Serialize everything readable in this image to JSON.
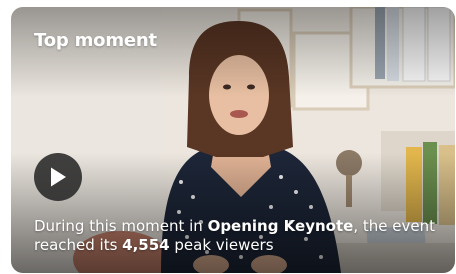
{
  "card": {
    "title": "Top moment",
    "caption": {
      "prefix": "During this moment in ",
      "event_name": "Opening Keynote",
      "middle": ", the event reached its ",
      "peak_viewers": "4,554",
      "suffix": " peak viewers"
    },
    "play_icon": "play-icon"
  }
}
